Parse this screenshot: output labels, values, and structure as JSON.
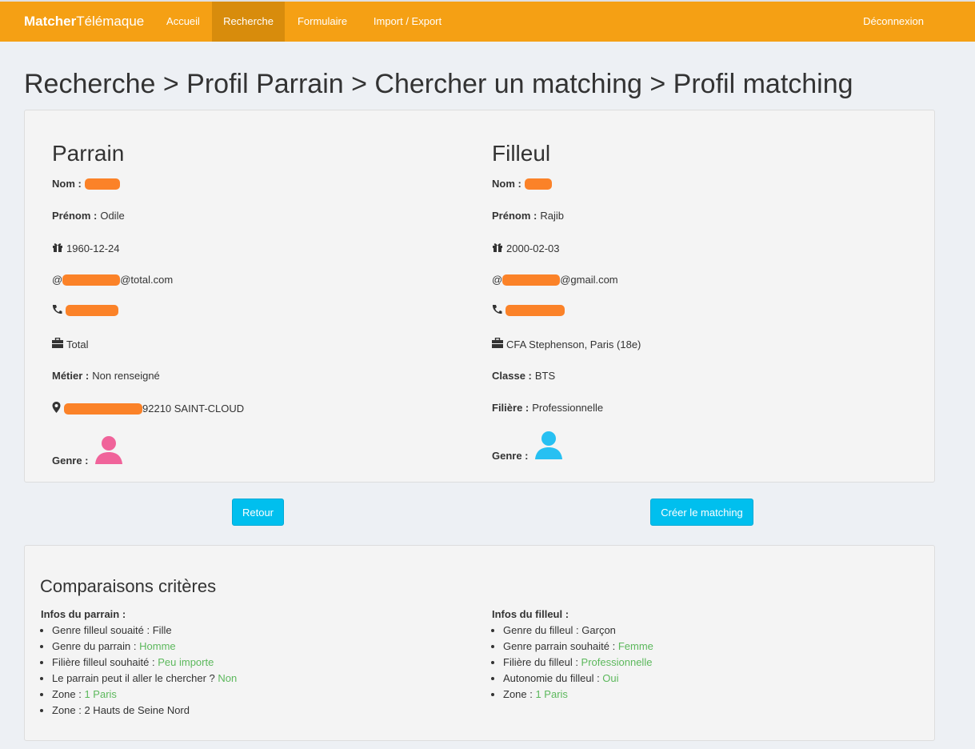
{
  "nav": {
    "brand_bold": "Matcher",
    "brand_rest": "Télémaque",
    "items": [
      "Accueil",
      "Recherche",
      "Formulaire",
      "Import / Export"
    ],
    "active": "Recherche",
    "logout": "Déconnexion"
  },
  "title": "Recherche > Profil Parrain > Chercher un matching > Profil matching",
  "parrain": {
    "heading": "Parrain",
    "nom_label": "Nom :",
    "prenom_label": "Prénom :",
    "prenom": "Odile",
    "birthdate": "1960-12-24",
    "email_prefix": "@",
    "email_domain": "@total.com",
    "company": "Total",
    "metier_label": "Métier :",
    "metier": "Non renseigné",
    "address_suffix": "92210 SAINT-CLOUD",
    "genre_label": "Genre :",
    "genre_color": "#f0639a"
  },
  "filleul": {
    "heading": "Filleul",
    "nom_label": "Nom :",
    "prenom_label": "Prénom :",
    "prenom": "Rajib",
    "birthdate": "2000-02-03",
    "email_prefix": "@",
    "email_domain": "@gmail.com",
    "school": "CFA Stephenson, Paris (18e)",
    "classe_label": "Classe :",
    "classe": "BTS",
    "filiere_label": "Filière :",
    "filiere": "Professionnelle",
    "genre_label": "Genre :",
    "genre_color": "#27c0f2"
  },
  "buttons": {
    "retour": "Retour",
    "creer": "Créer le matching"
  },
  "criteria": {
    "title": "Comparaisons critères",
    "parrain_head": "Infos du parrain :",
    "parrain_items": [
      {
        "label": "Genre filleul souaité :",
        "value": "Fille",
        "green": false
      },
      {
        "label": "Genre du parrain :",
        "value": "Homme",
        "green": true
      },
      {
        "label": "Filière filleul souhaité :",
        "value": "Peu importe",
        "green": true
      },
      {
        "label": "Le parrain peut il aller le chercher ?",
        "value": "Non",
        "green": true
      },
      {
        "label": "Zone :",
        "value": "1 Paris",
        "green": true
      },
      {
        "label": "Zone :",
        "value": "2 Hauts de Seine Nord",
        "green": false
      }
    ],
    "filleul_head": "Infos du filleul :",
    "filleul_items": [
      {
        "label": "Genre du filleul :",
        "value": "Garçon",
        "green": false
      },
      {
        "label": "Genre parrain souhaité :",
        "value": "Femme",
        "green": true
      },
      {
        "label": "Filière du filleul :",
        "value": "Professionnelle",
        "green": true
      },
      {
        "label": "Autonomie du filleul :",
        "value": "Oui",
        "green": true
      },
      {
        "label": "Zone :",
        "value": "1 Paris",
        "green": true
      }
    ],
    "green_color": "#5cb85c"
  }
}
